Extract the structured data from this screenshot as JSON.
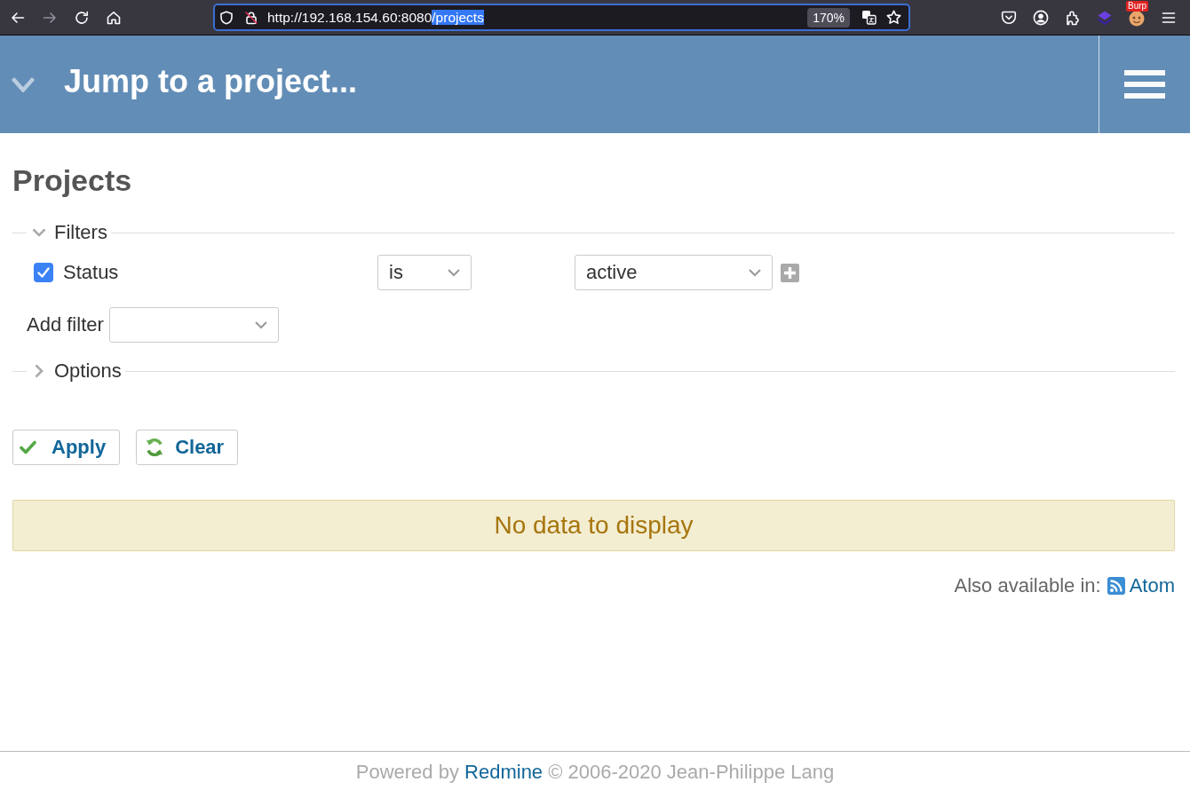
{
  "browser": {
    "nav_buttons": [
      {
        "kind": "back",
        "disabled": false
      },
      {
        "kind": "forward",
        "disabled": true
      },
      {
        "kind": "reload",
        "disabled": false
      },
      {
        "kind": "home",
        "disabled": false
      }
    ],
    "address": {
      "url": [
        {
          "text": "http://192.168.154.60:8080",
          "selected": false
        },
        {
          "text": "/projects",
          "selected": true
        }
      ],
      "zoom": "170%"
    },
    "toolbar_icons": [
      {
        "kind": "pocket"
      },
      {
        "kind": "account"
      },
      {
        "kind": "extensions"
      },
      {
        "kind": "layers"
      },
      {
        "kind": "badged",
        "badge": "Burp"
      },
      {
        "kind": "menu"
      }
    ]
  },
  "header": {
    "project_jump": "Jump to a project..."
  },
  "page_title": "Projects",
  "filters": {
    "legend": "Filters",
    "expanded": true,
    "rows": [
      {
        "label": "Status",
        "checked": true,
        "operator": "is",
        "value": "active"
      }
    ],
    "add_filter": {
      "label": "Add filter"
    }
  },
  "options": {
    "legend": "Options",
    "expanded": false
  },
  "buttons": [
    {
      "kind": "apply",
      "label": "Apply"
    },
    {
      "kind": "clear",
      "label": "Clear"
    }
  ],
  "notice": "No data to display",
  "other_formats": {
    "label": "Also available in:",
    "links": [
      {
        "kind": "atom",
        "label": "Atom"
      }
    ]
  },
  "footer": {
    "before": "Powered by",
    "link": "Redmine",
    "after": "© 2006-2020 Jean-Philippe Lang"
  }
}
